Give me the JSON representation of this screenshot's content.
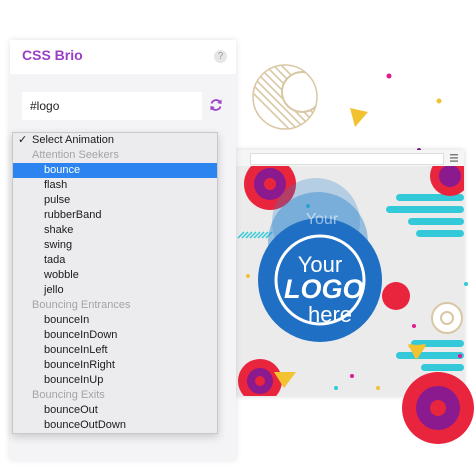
{
  "panel": {
    "title": "CSS Brio",
    "help": "?",
    "selector_value": "#logo"
  },
  "dropdown": {
    "selected_label": "Select Animation",
    "options": [
      {
        "type": "group",
        "label": "Attention Seekers"
      },
      {
        "type": "item",
        "label": "bounce",
        "highlighted": true
      },
      {
        "type": "item",
        "label": "flash"
      },
      {
        "type": "item",
        "label": "pulse"
      },
      {
        "type": "item",
        "label": "rubberBand"
      },
      {
        "type": "item",
        "label": "shake"
      },
      {
        "type": "item",
        "label": "swing"
      },
      {
        "type": "item",
        "label": "tada"
      },
      {
        "type": "item",
        "label": "wobble"
      },
      {
        "type": "item",
        "label": "jello"
      },
      {
        "type": "group",
        "label": "Bouncing Entrances"
      },
      {
        "type": "item",
        "label": "bounceIn"
      },
      {
        "type": "item",
        "label": "bounceInDown"
      },
      {
        "type": "item",
        "label": "bounceInLeft"
      },
      {
        "type": "item",
        "label": "bounceInRight"
      },
      {
        "type": "item",
        "label": "bounceInUp"
      },
      {
        "type": "group",
        "label": "Bouncing Exits"
      },
      {
        "type": "item",
        "label": "bounceOut"
      },
      {
        "type": "item",
        "label": "bounceOutDown"
      }
    ]
  },
  "preview": {
    "logo_lines": [
      "Your",
      "LOGO",
      "here"
    ],
    "ghost_text": "Your"
  },
  "colors": {
    "title": "#9b3fc7",
    "highlight": "#2c84f0",
    "logo_blue": "#1f6fc4",
    "accent_purple": "#8b1a8e",
    "accent_red": "#e8253d",
    "accent_yellow": "#f2c230",
    "accent_teal": "#33c9d8",
    "accent_pink": "#e0198e"
  },
  "icons": {
    "refresh": "refresh-icon",
    "check": "checkmark-icon",
    "menu": "hamburger-menu-icon",
    "help": "help-icon"
  }
}
